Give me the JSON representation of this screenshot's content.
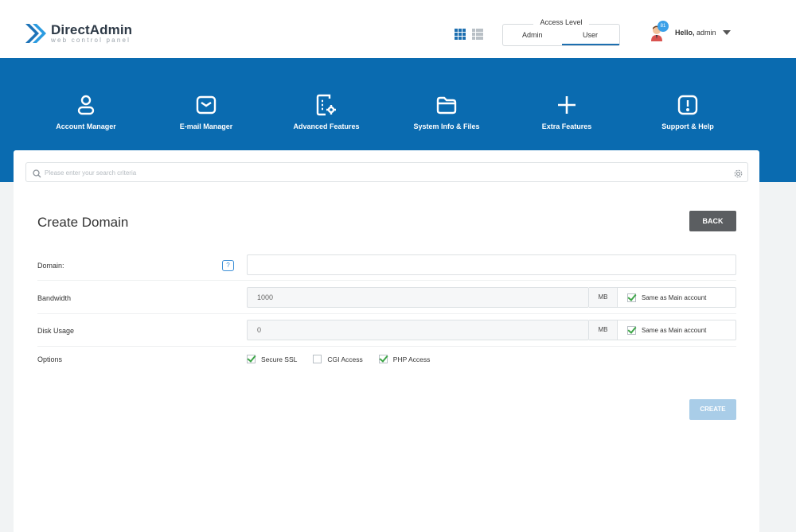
{
  "header": {
    "logo_title": "DirectAdmin",
    "logo_subtitle": "web control panel",
    "access_level": {
      "label": "Access Level",
      "options": [
        "Admin",
        "User"
      ],
      "selected": "User"
    },
    "user": {
      "badge_count": "81",
      "greeting": "Hello,",
      "name": "admin"
    }
  },
  "nav": [
    {
      "label": "Account Manager",
      "icon": "user-icon"
    },
    {
      "label": "E-mail Manager",
      "icon": "mail-icon"
    },
    {
      "label": "Advanced Features",
      "icon": "document-settings-icon"
    },
    {
      "label": "System Info & Files",
      "icon": "folder-icon"
    },
    {
      "label": "Extra Features",
      "icon": "plus-icon"
    },
    {
      "label": "Support & Help",
      "icon": "alert-icon"
    }
  ],
  "search": {
    "placeholder": "Please enter your search criteria"
  },
  "page": {
    "title": "Create Domain",
    "back_label": "BACK",
    "create_label": "CREATE"
  },
  "form": {
    "domain_label": "Domain:",
    "domain_value": "",
    "help_glyph": "?",
    "bandwidth_label": "Bandwidth",
    "bandwidth_value": "1000",
    "bandwidth_unit": "MB",
    "bandwidth_same_label": "Same as Main account",
    "bandwidth_same_checked": true,
    "disk_label": "Disk Usage",
    "disk_value": "0",
    "disk_unit": "MB",
    "disk_same_label": "Same as Main account",
    "disk_same_checked": true,
    "options_label": "Options",
    "options": [
      {
        "label": "Secure SSL",
        "checked": true
      },
      {
        "label": "CGI Access",
        "checked": false
      },
      {
        "label": "PHP Access",
        "checked": true
      }
    ]
  },
  "colors": {
    "brand_blue": "#0a6bb0",
    "check_green": "#3ea548",
    "back_button": "#5b5e61",
    "create_button": "#a9cde8"
  }
}
